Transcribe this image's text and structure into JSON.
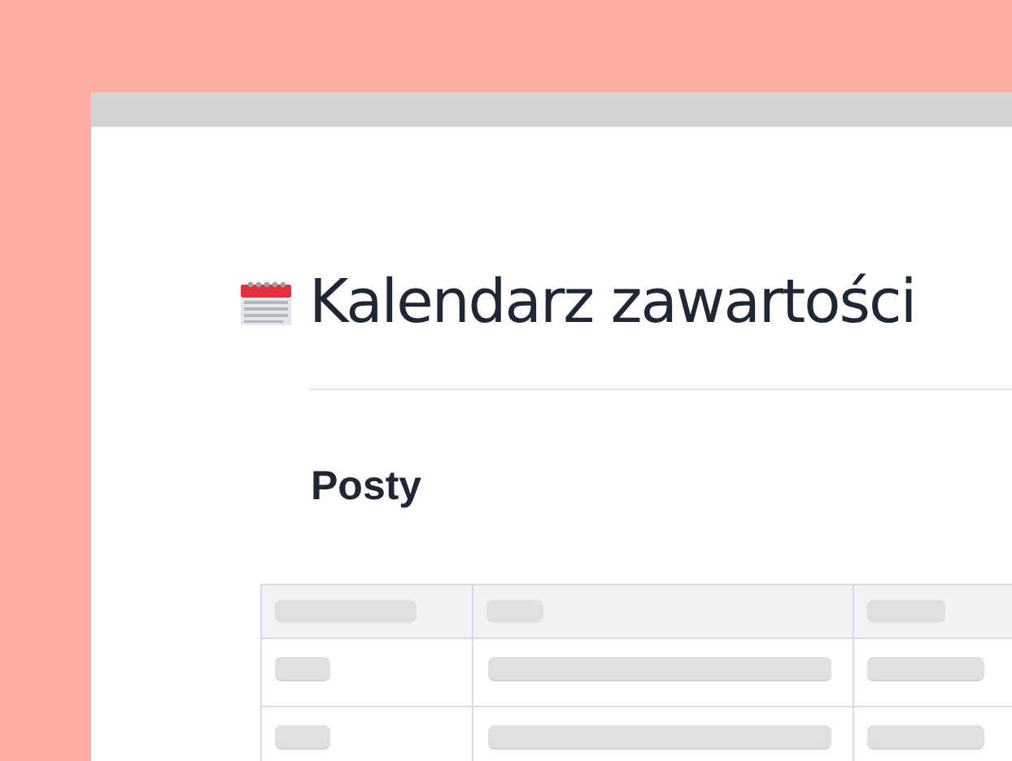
{
  "page": {
    "title": "Kalendarz zawartości"
  },
  "section": {
    "heading": "Posty"
  }
}
